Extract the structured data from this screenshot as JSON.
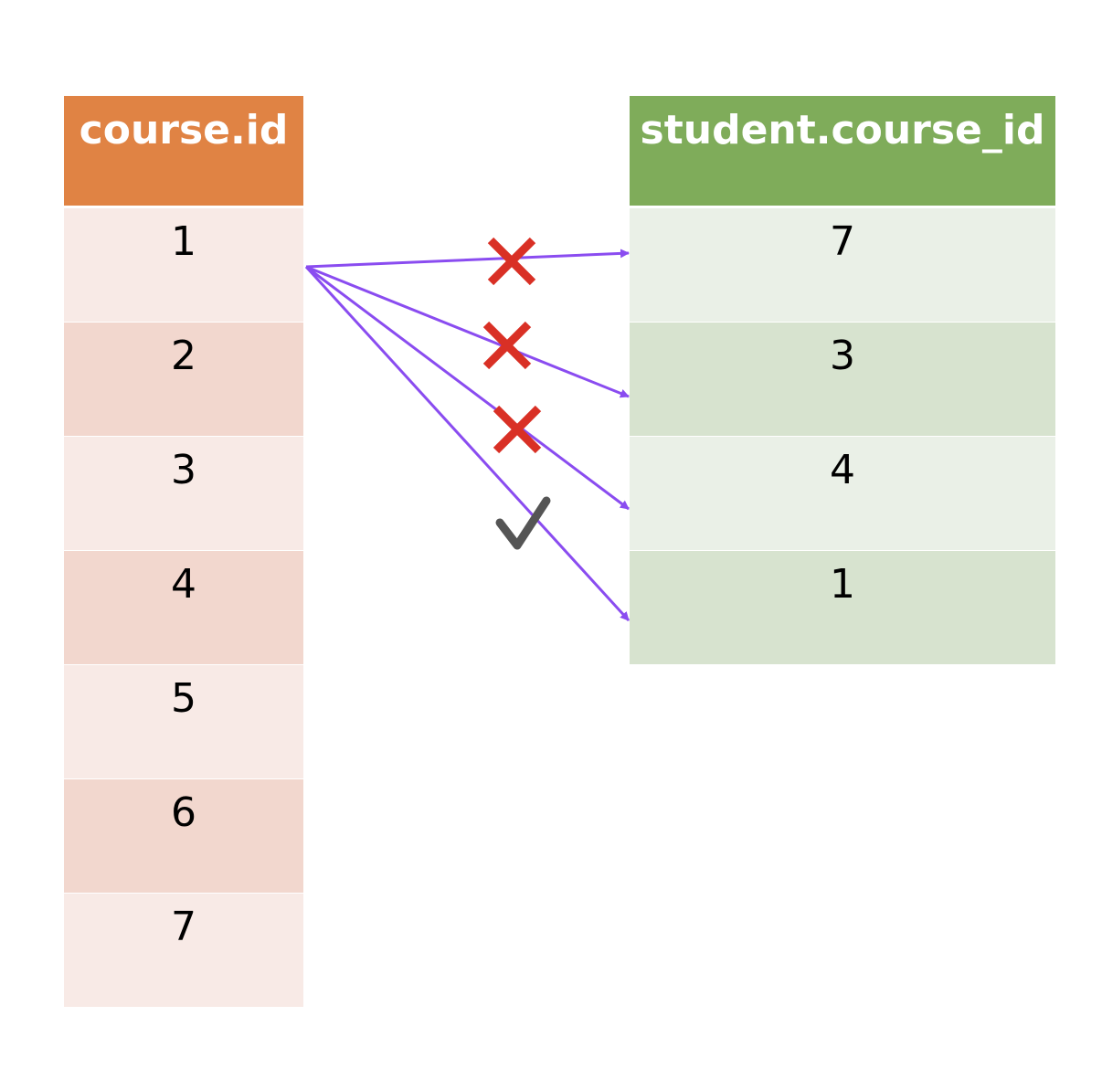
{
  "course_table": {
    "header": "course.id",
    "rows": [
      "1",
      "2",
      "3",
      "4",
      "5",
      "6",
      "7"
    ]
  },
  "student_table": {
    "header": "student.course_id",
    "rows": [
      "7",
      "3",
      "4",
      "1"
    ]
  },
  "comparisons": [
    {
      "from": "1",
      "to": "7",
      "match": false
    },
    {
      "from": "1",
      "to": "3",
      "match": false
    },
    {
      "from": "1",
      "to": "4",
      "match": false
    },
    {
      "from": "1",
      "to": "1",
      "match": true
    }
  ],
  "colors": {
    "course_header": "#e08344",
    "student_header": "#7fac5a",
    "arrow": "#8a4cf0",
    "mismatch": "#d93025",
    "match": "#555555"
  }
}
